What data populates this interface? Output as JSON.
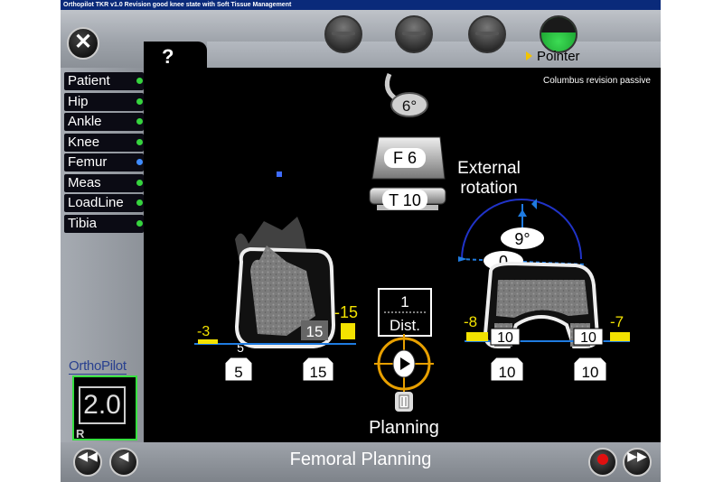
{
  "window": {
    "title": "Orthopilot TKR v1.0 Revision good knee state with Soft Tissue Management"
  },
  "header": {
    "help_label": "?",
    "close_label": "✕",
    "mode_label": "Pointer"
  },
  "status": "Columbus revision passive",
  "sidebar": {
    "items": [
      {
        "label": "Patient",
        "status_color": "#36d43e"
      },
      {
        "label": "Hip",
        "status_color": "#36d43e"
      },
      {
        "label": "Ankle",
        "status_color": "#36d43e"
      },
      {
        "label": "Knee",
        "status_color": "#36d43e"
      },
      {
        "label": "Femur",
        "status_color": "#3f8cff"
      },
      {
        "label": "Meas",
        "status_color": "#36d43e"
      },
      {
        "label": "LoadLine",
        "status_color": "#36d43e"
      },
      {
        "label": "Tibia",
        "status_color": "#36d43e"
      }
    ]
  },
  "logo": {
    "text": "OrthoPilot",
    "version": "2.0",
    "side": "R"
  },
  "implant": {
    "angle": "6°",
    "femur": "F 6",
    "tibia": "T 10"
  },
  "frontal": {
    "left_offset": "-3",
    "right_offset": "-15",
    "left_gap": "5",
    "right_gap": "15",
    "left_value": "5",
    "right_value": "15"
  },
  "stepper": {
    "count": "1",
    "unit": "Dist."
  },
  "planning_label": "Planning",
  "rotation": {
    "title_line1": "External",
    "title_line2": "rotation",
    "angle": "9°",
    "reference": "0",
    "left_offset": "-8",
    "right_offset": "-7",
    "left_gap": "10",
    "right_gap": "10",
    "left_value": "10",
    "right_value": "10"
  },
  "footer": {
    "title": "Femoral Planning"
  },
  "colors": {
    "accent_yellow": "#f3e200",
    "line_blue": "#1f7be0",
    "ok_green": "#36d43e",
    "record_red": "#e01010",
    "cursor_orange": "#e8a000"
  }
}
